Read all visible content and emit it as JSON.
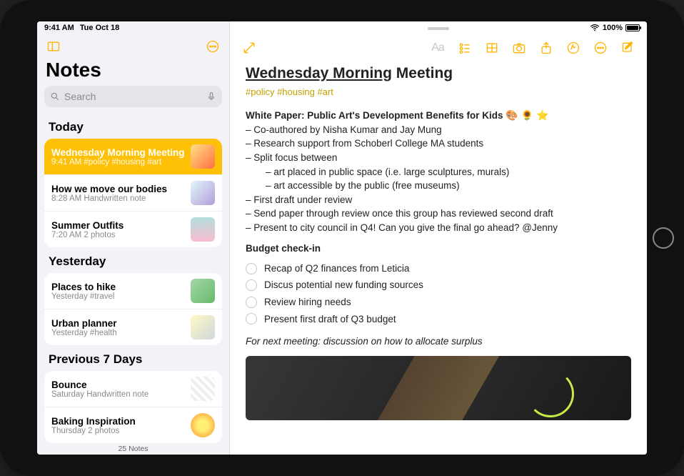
{
  "status": {
    "time": "9:41 AM",
    "date": "Tue Oct 18",
    "battery_pct": "100%"
  },
  "sidebar": {
    "title": "Notes",
    "search_placeholder": "Search",
    "footer": "25 Notes",
    "sections": [
      {
        "header": "Today",
        "items": [
          {
            "title": "Wednesday Morning Meeting",
            "sub": "9:41 AM  #policy #housing #art",
            "selected": true,
            "thumb": "a"
          },
          {
            "title": "How we move our bodies",
            "sub": "8:28 AM  Handwritten note",
            "thumb": "b"
          },
          {
            "title": "Summer Outfits",
            "sub": "7:20 AM  2 photos",
            "thumb": "c"
          }
        ]
      },
      {
        "header": "Yesterday",
        "items": [
          {
            "title": "Places to hike",
            "sub": "Yesterday  #travel",
            "thumb": "d"
          },
          {
            "title": "Urban planner",
            "sub": "Yesterday  #health",
            "thumb": "e"
          }
        ]
      },
      {
        "header": "Previous 7 Days",
        "items": [
          {
            "title": "Bounce",
            "sub": "Saturday  Handwritten note",
            "thumb": "f"
          },
          {
            "title": "Baking Inspiration",
            "sub": "Thursday  2 photos",
            "thumb": "g"
          }
        ]
      }
    ]
  },
  "note": {
    "title_underlined": "Wednesday Morning",
    "title_rest": " Meeting",
    "tags": "#policy #housing #art",
    "section1_title": "White Paper: Public Art's Development Benefits for Kids",
    "section1_emoji": "🎨 🌻 ⭐",
    "lines": [
      "– Co-authored by Nisha Kumar and Jay Mung",
      "– Research support from Schoberl College MA students",
      "– Split focus between"
    ],
    "indent_lines": [
      "– art placed in public space (i.e. large sculptures, murals)",
      "– art accessible by the public (free museums)"
    ],
    "lines2": [
      "– First draft under review",
      "– Send paper through review once this group has reviewed second draft",
      "– Present to city council in Q4! Can you give the final go ahead? @Jenny"
    ],
    "section2_title": "Budget check-in",
    "checklist": [
      "Recap of Q2 finances from Leticia",
      "Discus potential new funding sources",
      "Review hiring needs",
      "Present first draft of Q3 budget"
    ],
    "footer_italic": "For next meeting: discussion on how to allocate surplus"
  },
  "toolbar_aa": "Aa"
}
